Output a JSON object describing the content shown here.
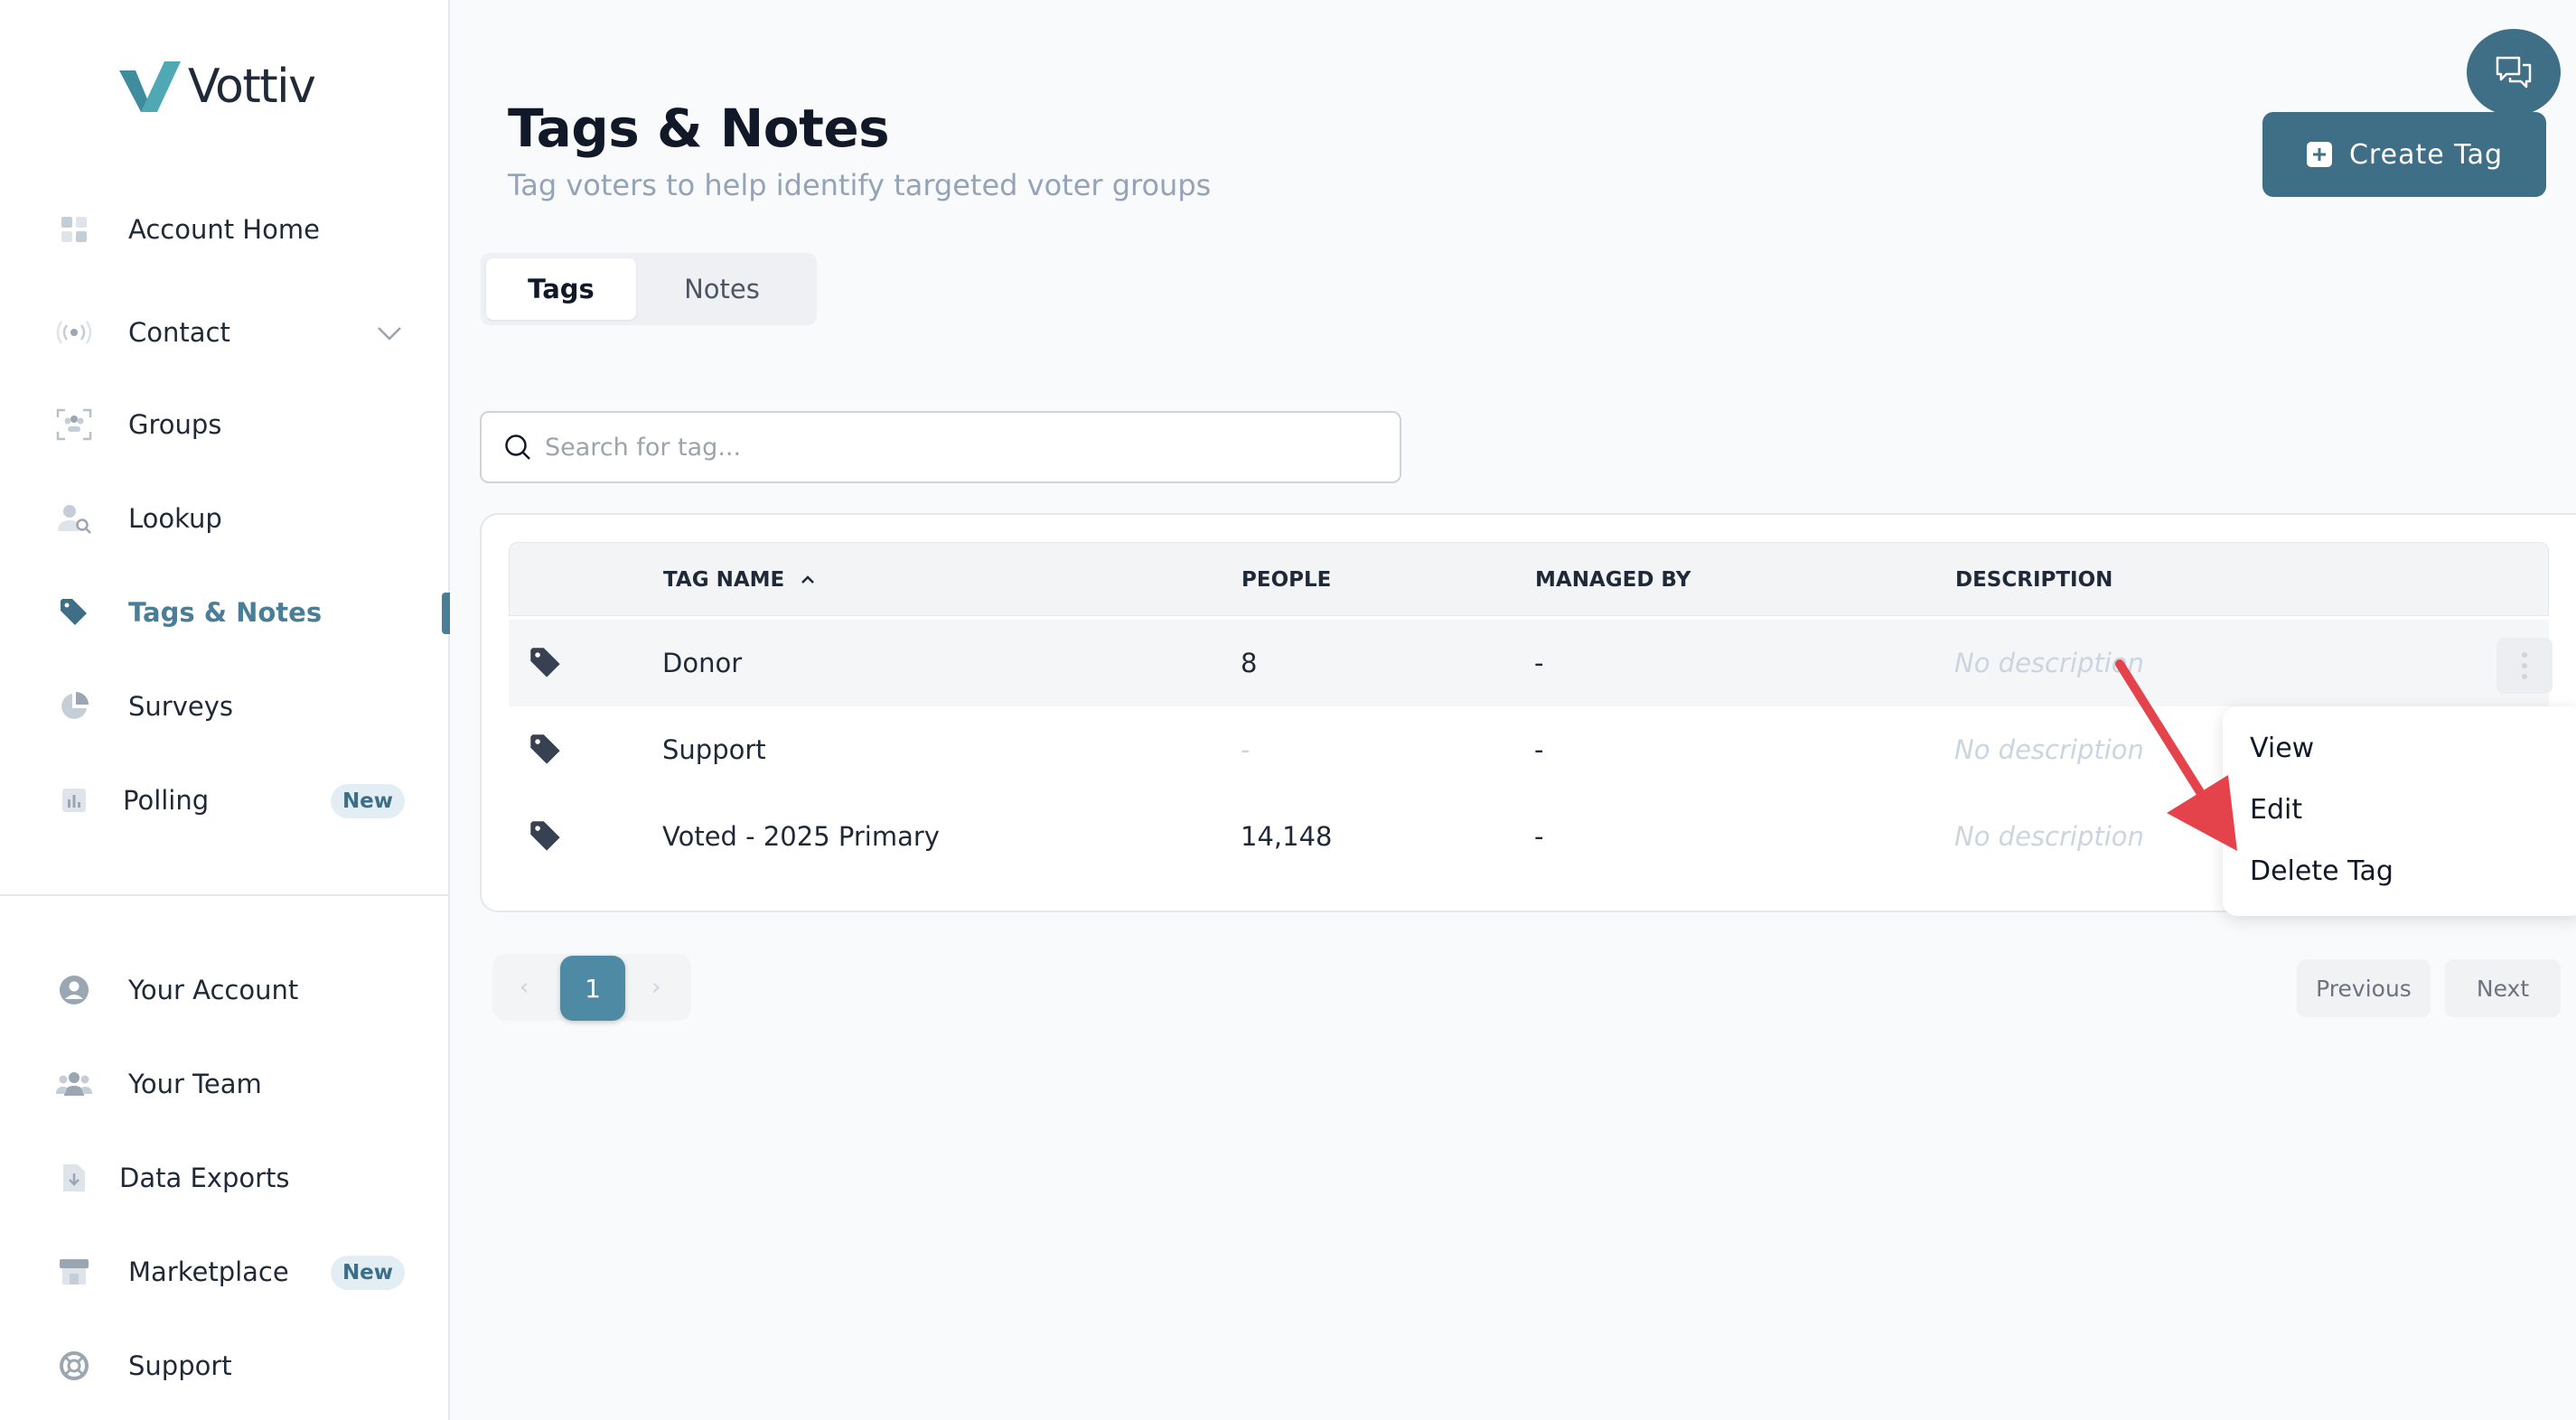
{
  "brand": {
    "name": "Vottiv"
  },
  "colors": {
    "accent": "#3f6f86",
    "accent_light": "#4f8aa5",
    "annotation": "#e5434b"
  },
  "sidebar": {
    "items": [
      {
        "label": "Account Home",
        "icon": "grid-icon"
      },
      {
        "label": "Contact",
        "icon": "broadcast-icon"
      },
      {
        "label": "Groups",
        "icon": "groups-icon"
      },
      {
        "label": "Lookup",
        "icon": "person-search-icon"
      },
      {
        "label": "Tags & Notes",
        "icon": "tag-icon"
      },
      {
        "label": "Surveys",
        "icon": "pie-chart-icon"
      },
      {
        "label": "Polling",
        "icon": "bar-chart-icon",
        "badge": "New"
      }
    ],
    "bottom_items": [
      {
        "label": "Your Account",
        "icon": "user-circle-icon"
      },
      {
        "label": "Your Team",
        "icon": "team-icon"
      },
      {
        "label": "Data Exports",
        "icon": "file-download-icon"
      },
      {
        "label": "Marketplace",
        "icon": "store-icon",
        "badge": "New"
      },
      {
        "label": "Support",
        "icon": "lifebuoy-icon"
      }
    ]
  },
  "header": {
    "title": "Tags & Notes",
    "subtitle": "Tag voters to help identify targeted voter groups",
    "create_button": "Create Tag"
  },
  "tabs": [
    {
      "label": "Tags",
      "active": true
    },
    {
      "label": "Notes",
      "active": false
    }
  ],
  "search": {
    "placeholder": "Search for tag..."
  },
  "table": {
    "columns": [
      "TAG NAME",
      "PEOPLE",
      "MANAGED BY",
      "DESCRIPTION"
    ],
    "rows": [
      {
        "name": "Donor",
        "people": "8",
        "managed_by": "-",
        "description": "No description"
      },
      {
        "name": "Support",
        "people": "-",
        "managed_by": "-",
        "description": "No description"
      },
      {
        "name": "Voted - 2025 Primary",
        "people": "14,148",
        "managed_by": "-",
        "description": "No description"
      }
    ]
  },
  "row_menu": {
    "items": [
      "View",
      "Edit",
      "Delete Tag"
    ]
  },
  "pagination": {
    "current_page": "1",
    "previous": "Previous",
    "next": "Next"
  }
}
